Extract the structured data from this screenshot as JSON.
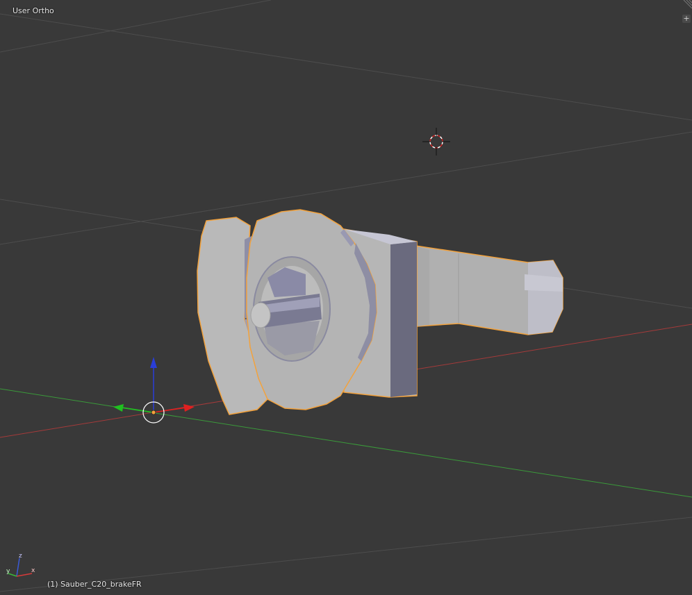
{
  "viewport": {
    "view_label": "User Ortho",
    "object_label": "(1) Sauber_C20_brakeFR",
    "plus_button": "+",
    "colors": {
      "background": "#393939",
      "grid": "#4d4d4d",
      "axis_x": "#a53a3a",
      "axis_y": "#3a9a3a",
      "selection_outline": "#f3a23c",
      "mesh_face": "#b3b3b3",
      "mesh_shade": "#8a8aa6",
      "manipulator_z": "#2a3ed8",
      "manipulator_x": "#e02020",
      "manipulator_y": "#20c020"
    },
    "axis_widget": {
      "x": "x",
      "y": "y",
      "z": "z"
    },
    "icons": [
      "3d-cursor-icon",
      "transform-manipulator-icon",
      "axis-orientation-icon",
      "plus-icon"
    ]
  }
}
